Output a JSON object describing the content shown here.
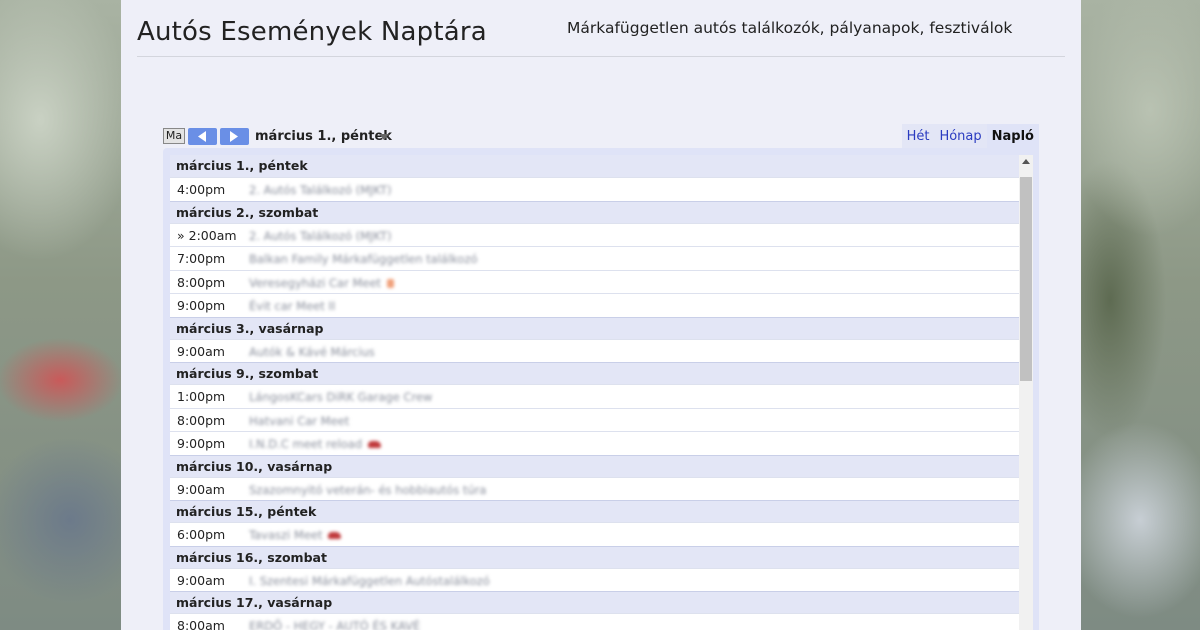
{
  "header": {
    "title": "Autós Események Naptára",
    "tagline": "Márkafüggetlen autós találkozók, pályanapok, fesztiválok"
  },
  "toolbar": {
    "today_label": "Ma",
    "current_date": "március 1., péntek",
    "views": [
      {
        "label": "Hét",
        "active": false
      },
      {
        "label": "Hónap",
        "active": false
      },
      {
        "label": "Napló",
        "active": true
      }
    ]
  },
  "agenda": [
    {
      "day": "március 1., péntek",
      "events": [
        {
          "time": "4:00pm",
          "title": "2. Autós Találkozó (MJKT)",
          "icon": ""
        }
      ]
    },
    {
      "day": "március 2., szombat",
      "events": [
        {
          "time": "» 2:00am",
          "title": "2. Autós Találkozó (MJKT)",
          "icon": ""
        },
        {
          "time": "7:00pm",
          "title": "Balkan Family Márkafüggetlen találkozó",
          "icon": ""
        },
        {
          "time": "8:00pm",
          "title": "Veresegyházi Car Meet",
          "icon": "warning-icon"
        },
        {
          "time": "9:00pm",
          "title": "Évit car Meet II",
          "icon": ""
        }
      ]
    },
    {
      "day": "március 3., vasárnap",
      "events": [
        {
          "time": "9:00am",
          "title": "Autók & Kávé Március",
          "icon": ""
        }
      ]
    },
    {
      "day": "március 9., szombat",
      "events": [
        {
          "time": "1:00pm",
          "title": "LángosKCars DiRK Garage Crew",
          "icon": ""
        },
        {
          "time": "8:00pm",
          "title": "Hatvani Car Meet",
          "icon": ""
        },
        {
          "time": "9:00pm",
          "title": "I.N.D.C meet reload",
          "icon": "car-icon"
        }
      ]
    },
    {
      "day": "március 10., vasárnap",
      "events": [
        {
          "time": "9:00am",
          "title": "Szazomnyitó veterán- és hobbiautós túra",
          "icon": ""
        }
      ]
    },
    {
      "day": "március 15., péntek",
      "events": [
        {
          "time": "6:00pm",
          "title": "Tavaszi Meet",
          "icon": "car-icon"
        }
      ]
    },
    {
      "day": "március 16., szombat",
      "events": [
        {
          "time": "9:00am",
          "title": "I. Szentesi Márkafüggetlen Autóstalálkozó",
          "icon": ""
        }
      ]
    },
    {
      "day": "március 17., vasárnap",
      "events": [
        {
          "time": "8:00am",
          "title": "ERDŐ - HEGY - AUTÓ ÉS KAVÉ",
          "icon": ""
        }
      ]
    }
  ],
  "colors": {
    "nav_button": "#6a8fe6",
    "day_header_bg": "#e3e6f6",
    "link": "#2a3bc0",
    "page_bg": "#eeeff8"
  }
}
